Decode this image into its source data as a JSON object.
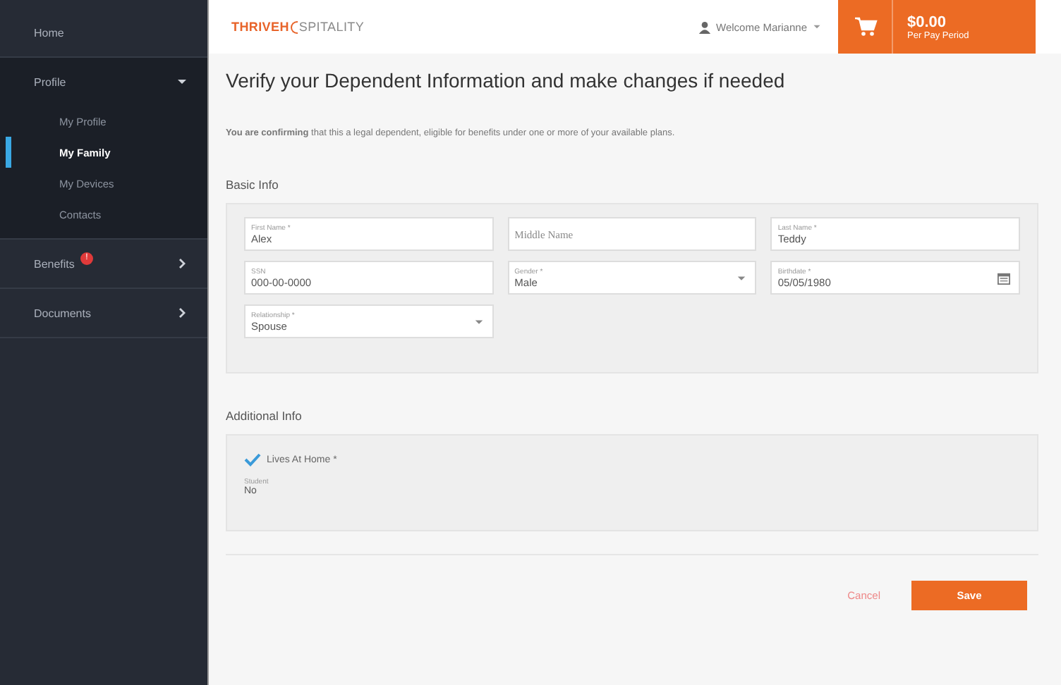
{
  "sidebar": {
    "items": [
      {
        "label": "Home",
        "expanded": false,
        "kind": "plain"
      },
      {
        "label": "Profile",
        "expanded": true,
        "kind": "group",
        "children": [
          {
            "label": "My Profile",
            "selected": false
          },
          {
            "label": "My Family",
            "selected": true
          },
          {
            "label": "My Devices",
            "selected": false
          },
          {
            "label": "Contacts",
            "selected": false
          }
        ]
      },
      {
        "label": "Benefits",
        "expanded": false,
        "kind": "group",
        "badge": "!"
      },
      {
        "label": "Documents",
        "expanded": false,
        "kind": "group"
      }
    ]
  },
  "header": {
    "logo": [
      "THRIVE",
      "H",
      "SPITALITY"
    ],
    "user": "Welcome Marianne",
    "cart": {
      "amount": "$0.00",
      "period": "Per Pay Period"
    }
  },
  "page": {
    "title": "Verify your Dependent Information and make changes if needed",
    "notice": "**You are confirming** that this a legal dependent, eligible for benefits under one or more of your available plans.",
    "basic_info": {
      "heading": "Basic Info",
      "fields": [
        {
          "label": "First Name *",
          "value": "Alex",
          "kind": "text"
        },
        {
          "placeholder": "Middle Name",
          "kind": "text"
        },
        {
          "label": "Last Name *",
          "value": "Teddy",
          "kind": "text"
        },
        {
          "label": "SSN",
          "value": "000-00-0000",
          "kind": "text"
        },
        {
          "label": "Gender *",
          "value": "Male",
          "kind": "select"
        },
        {
          "label": "Birthdate *",
          "value": "05/05/1980",
          "kind": "date"
        },
        {
          "label": "Relationship *",
          "value": "Spouse",
          "kind": "select"
        }
      ]
    },
    "additional_info": {
      "heading": "Additional Info",
      "checkbox": {
        "label": "Lives At Home *",
        "checked": true
      },
      "student": {
        "label": "Student",
        "value": "No"
      }
    },
    "buttons": {
      "cancel": "Cancel",
      "save": "Save"
    }
  }
}
